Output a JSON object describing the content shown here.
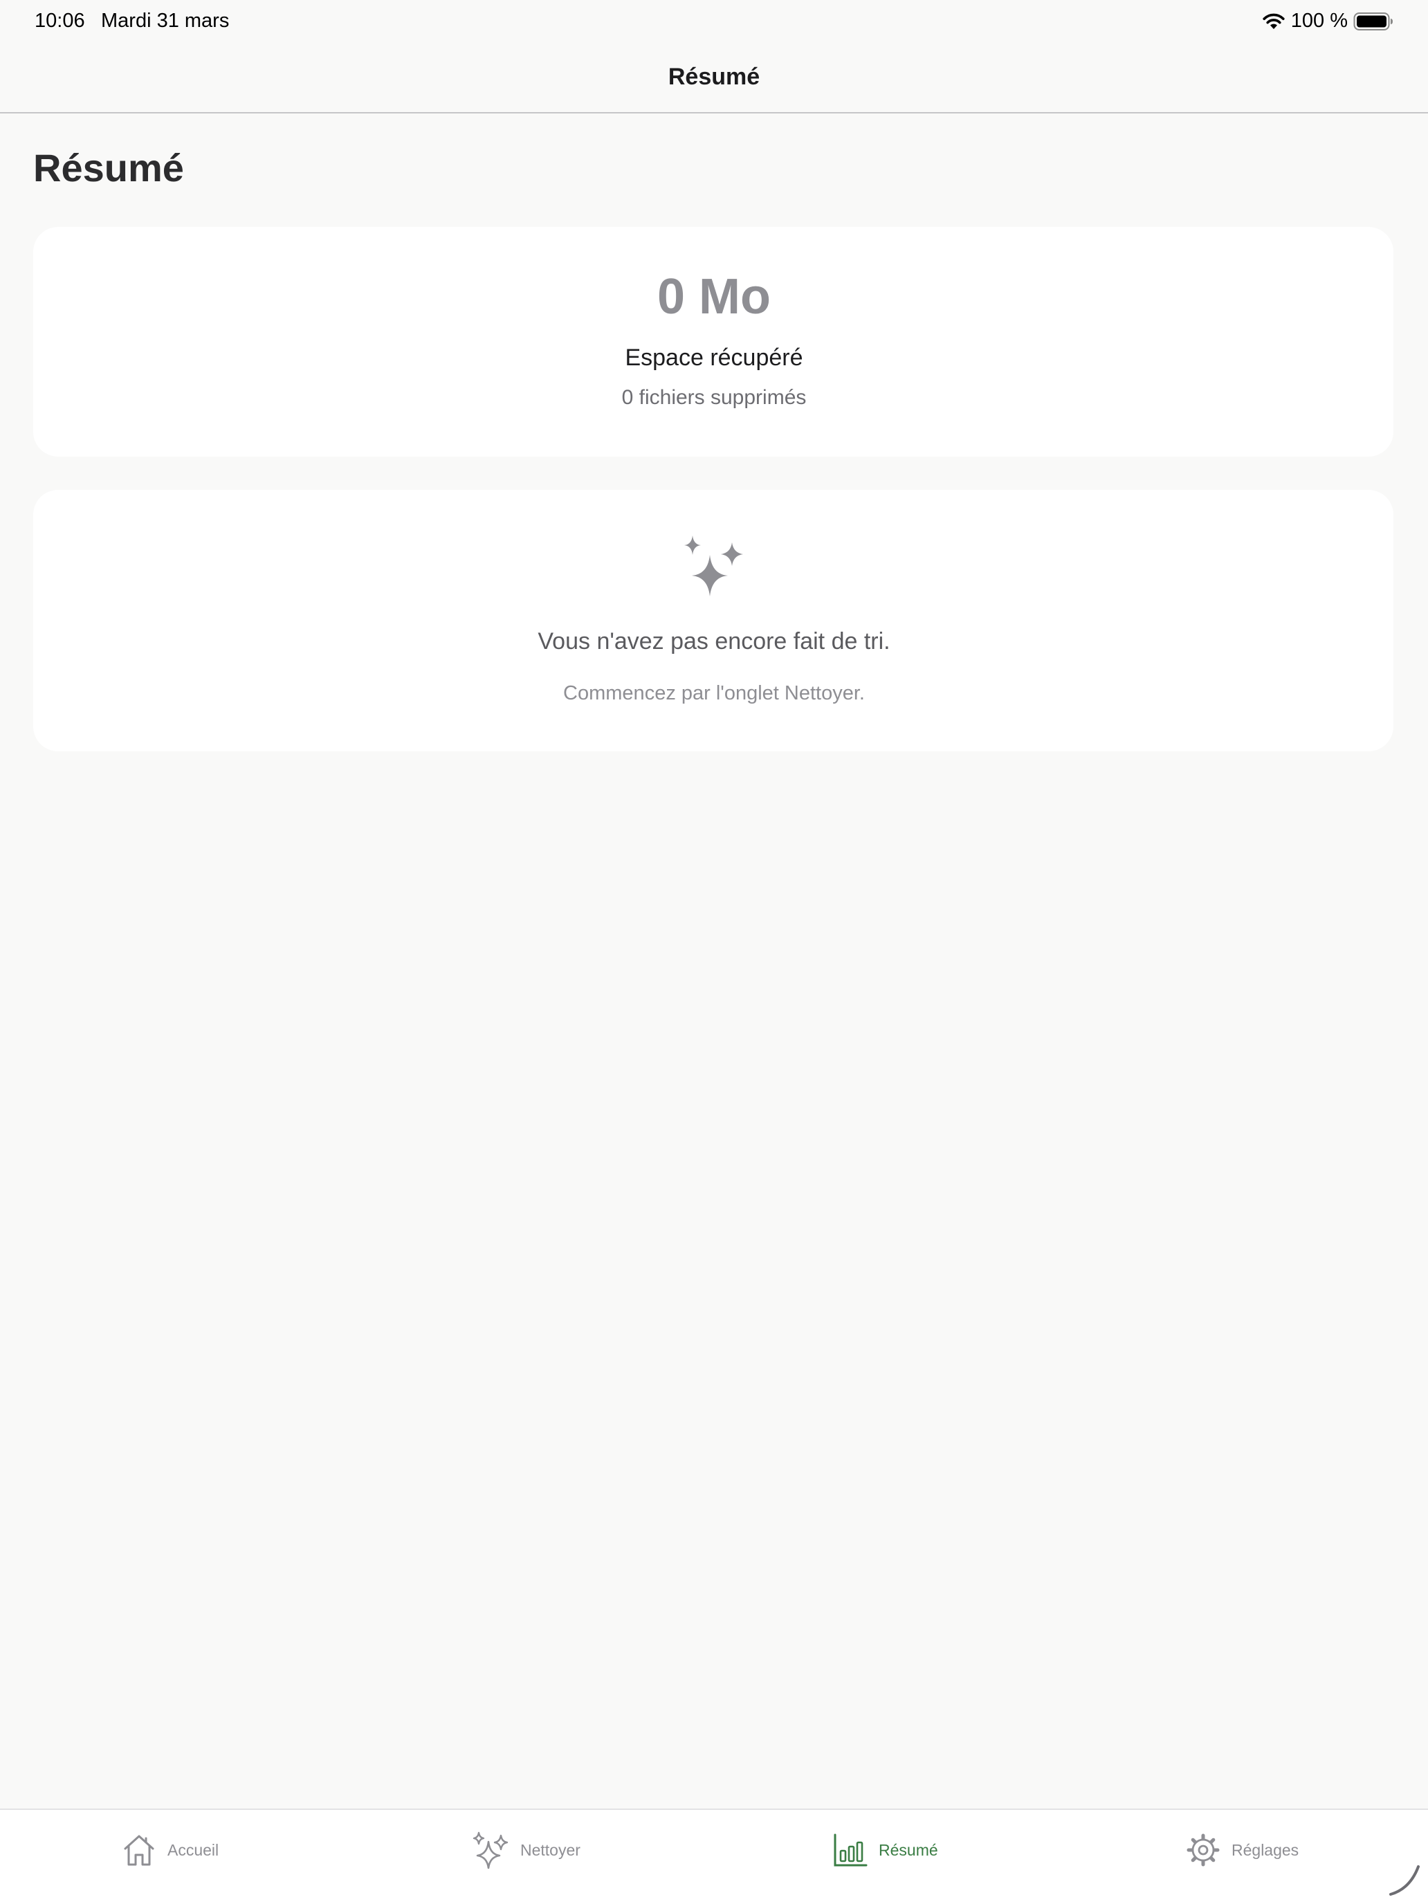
{
  "status_bar": {
    "time": "10:06",
    "date": "Mardi 31 mars",
    "battery_text": "100 %"
  },
  "nav": {
    "title": "Résumé"
  },
  "page": {
    "large_title": "Résumé"
  },
  "stats_card": {
    "value": "0 Mo",
    "label": "Espace récupéré",
    "subtitle": "0 fichiers supprimés"
  },
  "empty_card": {
    "icon": "sparkles-icon",
    "title": "Vous n'avez pas encore fait de tri.",
    "subtitle": "Commencez par l'onglet Nettoyer."
  },
  "tabs": [
    {
      "label": "Accueil",
      "icon": "house-icon",
      "active": false
    },
    {
      "label": "Nettoyer",
      "icon": "sparkles-icon",
      "active": false
    },
    {
      "label": "Résumé",
      "icon": "chart-bar-icon",
      "active": true
    },
    {
      "label": "Réglages",
      "icon": "gear-icon",
      "active": false
    }
  ],
  "colors": {
    "background": "#f9f9f8",
    "card": "#ffffff",
    "accent": "#3a7d44",
    "muted": "#8e8e93"
  }
}
